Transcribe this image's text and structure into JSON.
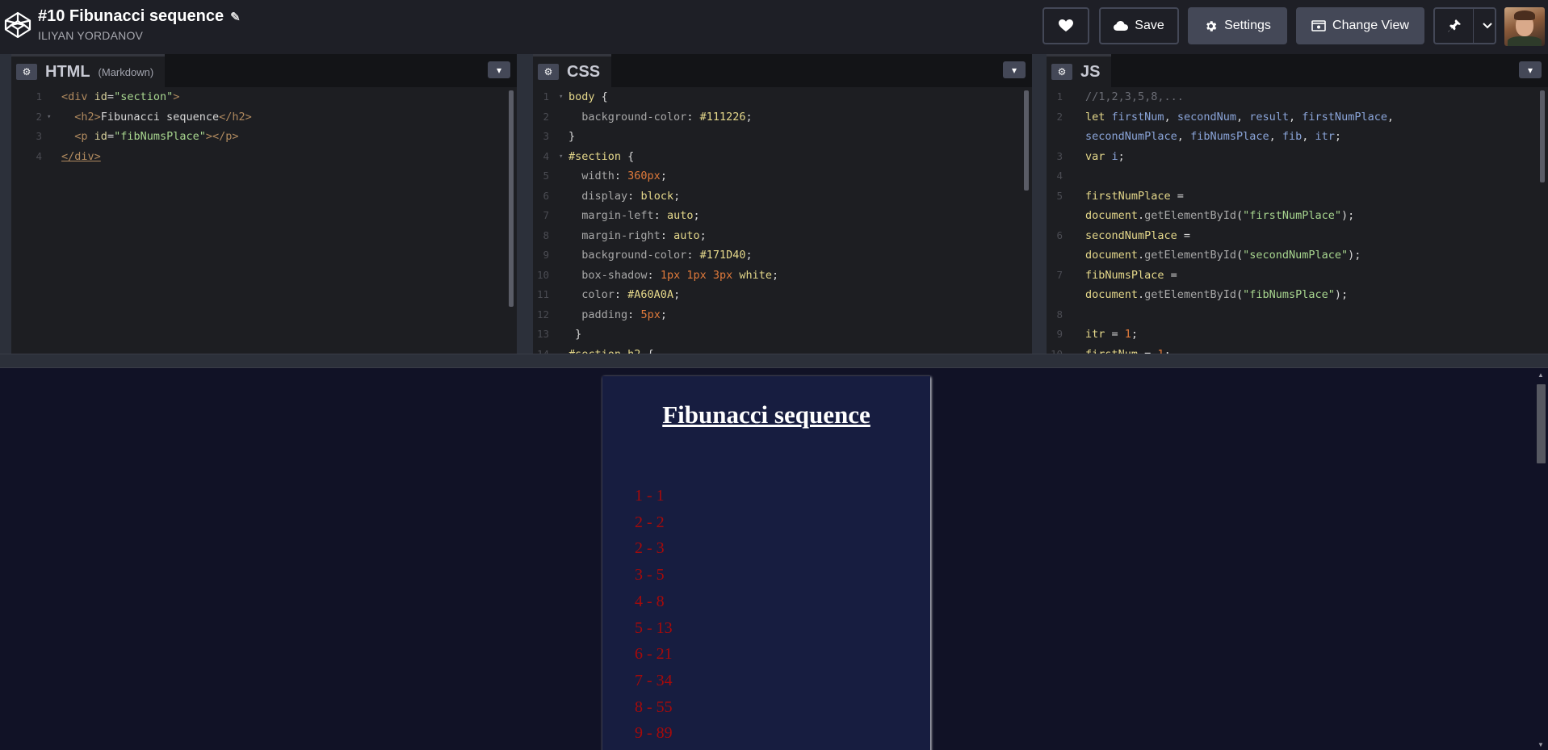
{
  "header": {
    "title": "#10 Fibunacci sequence",
    "author": "ILIYAN YORDANOV",
    "buttons": {
      "save": "Save",
      "settings": "Settings",
      "change_view": "Change View"
    }
  },
  "panels": {
    "html": {
      "name": "HTML",
      "sub": "(Markdown)"
    },
    "css": {
      "name": "CSS"
    },
    "js": {
      "name": "JS"
    }
  },
  "preview": {
    "heading": "Fibunacci sequence",
    "items": [
      "1 - 1",
      "2 - 2",
      "2 - 3",
      "3 - 5",
      "4 - 8",
      "5 - 13",
      "6 - 21",
      "7 - 34",
      "8 - 55",
      "9 - 89"
    ]
  },
  "colors": {
    "body_bg": "#111226",
    "section_bg": "#171D40",
    "text_color": "#A60A0A"
  },
  "icons": [
    "codepen-logo-icon",
    "pencil-icon",
    "heart-icon",
    "cloud-icon",
    "gear-icon",
    "change-view-icon",
    "pin-icon",
    "chevron-down-icon"
  ]
}
